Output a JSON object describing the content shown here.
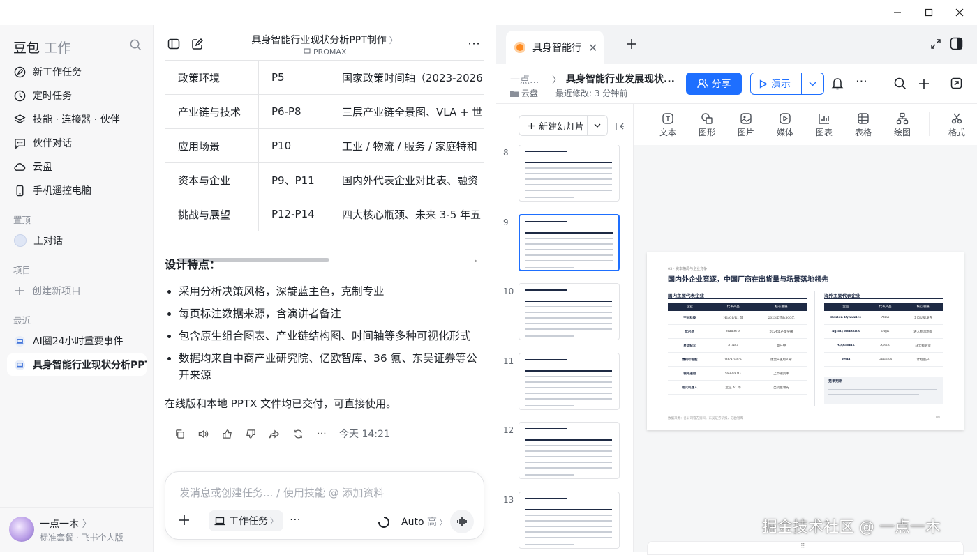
{
  "sidebar": {
    "brand": "豆包",
    "brand_sub": "工作",
    "nav": [
      {
        "label": "新工作任务",
        "icon": "edit-icon"
      },
      {
        "label": "定时任务",
        "icon": "clock-icon"
      },
      {
        "label": "技能 · 连接器 · 伙伴",
        "icon": "layers-icon"
      },
      {
        "label": "伙伴对话",
        "icon": "chat-icon"
      },
      {
        "label": "云盘",
        "icon": "cloud-icon"
      },
      {
        "label": "手机遥控电脑",
        "icon": "phone-icon"
      }
    ],
    "pinned_title": "置顶",
    "pinned": [
      {
        "label": "主对话"
      }
    ],
    "projects_title": "项目",
    "new_project": "创建新项目",
    "recent_title": "最近",
    "recent": [
      {
        "label": "AI圈24小时重要事件"
      },
      {
        "label": "具身智能行业现状分析PPT"
      }
    ],
    "user": {
      "name": "一点一木",
      "plan": "标准套餐 · 飞书个人版"
    }
  },
  "chat": {
    "title": "具身智能行业现状分析PPT制作",
    "subtitle": "PROMAX",
    "table_rows": [
      [
        "政策环境",
        "P5",
        "国家政策时间轴（2023-2026"
      ],
      [
        "产业链与技术",
        "P6-P8",
        "三层产业链全景图、VLA + 世"
      ],
      [
        "应用场景",
        "P10",
        "工业 / 物流 / 服务 / 家庭特和"
      ],
      [
        "资本与企业",
        "P9、P11",
        "国内外代表企业对比表、融资"
      ],
      [
        "挑战与展望",
        "P12-P14",
        "四大核心瓶颈、未来 3-5 年五"
      ]
    ],
    "heading": "设计特点：",
    "bullets": [
      "采用分析决策风格，深靛蓝主色，克制专业",
      "每页标注数据来源，含演讲者备注",
      "包含原生组合图表、产业链结构图、时间轴等多种可视化形式",
      "数据均来自中商产业研究院、亿欧智库、36 氪、东吴证券等公开来源"
    ],
    "conclusion": "在线版和本地 PPTX 文件均已交付，可直接使用。",
    "timestamp": "今天 14:21",
    "input_placeholder": "发消息或创建任务... / 使用技能 @ 添加资料",
    "mode_label": "工作任务",
    "auto_label": "Auto",
    "auto_level": "高"
  },
  "doc": {
    "tab_title": "具身智能行",
    "breadcrumb_parent": "一点...",
    "doc_title": "具身智能行业发展现状...",
    "location": "云盘",
    "modified": "最近修改: 3 分钟前",
    "share_label": "分享",
    "present_label": "演示",
    "new_slide_label": "新建幻灯片",
    "ribbon": [
      "文本",
      "图形",
      "图片",
      "媒体",
      "图表",
      "表格",
      "绘图",
      "格式"
    ],
    "thumb_numbers": [
      "8",
      "9",
      "10",
      "11",
      "12",
      "13"
    ]
  },
  "slide": {
    "kicker": "05 · 资本格局与企业竞争",
    "title": "国内外企业竞逐，中国厂商在出货量与场景落地领先",
    "domestic_title": "国内主要代表企业",
    "overseas_title": "海外主要代表企业",
    "headers": [
      "企业",
      "代表产品",
      "核心进展"
    ],
    "domestic": [
      [
        "宇树科技",
        "H1/G1/R1 等",
        "2025年营收500亿"
      ],
      [
        "优必选",
        "Walker S",
        "2024年产量突破"
      ],
      [
        "星动纪元",
        "STAR1",
        "量产中"
      ],
      [
        "傅利叶智能",
        "GR-1/GR-2",
        "康复+通用人形"
      ],
      [
        "银河通用",
        "Galbot G1",
        "上市融资中"
      ],
      [
        "智元机器人",
        "远征 A1 等",
        "出货量领先"
      ]
    ],
    "overseas": [
      [
        "Boston Dynamics",
        "Atlas",
        "全电动版发布"
      ],
      [
        "Agility Robotics",
        "Digit",
        "进入物流场景"
      ],
      [
        "Apptronik",
        "Apollo",
        "获大额融资"
      ],
      [
        "Tesla",
        "Optimus",
        "计划量产"
      ]
    ],
    "note_title": "竞争判断",
    "footer": "数据来源：各公司官方资料、东吴证券研报、亿欧智库",
    "page": "09"
  },
  "watermark": "掘金技术社区 @ 一点一木",
  "colors": {
    "accent": "#1e6fff",
    "slide_primary": "#1e2a44"
  }
}
